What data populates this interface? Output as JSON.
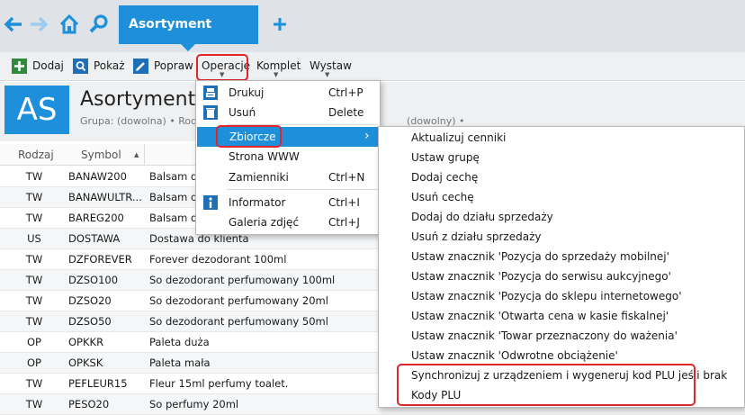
{
  "nav": {
    "active_tab": "Asortyment"
  },
  "toolbar": {
    "items": [
      {
        "label": "Dodaj"
      },
      {
        "label": "Pokaż"
      },
      {
        "label": "Popraw"
      },
      {
        "label": "Operacje"
      },
      {
        "label": "Komplet"
      },
      {
        "label": "Wystaw"
      }
    ]
  },
  "header": {
    "tile": "AS",
    "title": "Asortyment",
    "filter_left": "Grupa: (dowolna) • Rodz",
    "filter_right": "(dowolny) •"
  },
  "table": {
    "columns": [
      "Rodzaj",
      "Symbol"
    ],
    "rows": [
      {
        "kind": "TW",
        "symbol": "BANAW200",
        "name": "Balsam do"
      },
      {
        "kind": "TW",
        "symbol": "BANAWULTR...",
        "name": "Balsam do"
      },
      {
        "kind": "TW",
        "symbol": "BAREG200",
        "name": "Balsam do"
      },
      {
        "kind": "US",
        "symbol": "DOSTAWA",
        "name": "Dostawa do klienta"
      },
      {
        "kind": "TW",
        "symbol": "DZFOREVER",
        "name": "Forever dezodorant 100ml"
      },
      {
        "kind": "TW",
        "symbol": "DZSO100",
        "name": "So dezodorant perfumowany 100ml"
      },
      {
        "kind": "TW",
        "symbol": "DZSO20",
        "name": "So dezodorant perfumowany 20ml"
      },
      {
        "kind": "TW",
        "symbol": "DZSO50",
        "name": "So dezodorant perfumowany 50ml"
      },
      {
        "kind": "OP",
        "symbol": "OPKKR",
        "name": "Paleta duża"
      },
      {
        "kind": "OP",
        "symbol": "OPKSK",
        "name": "Paleta mała"
      },
      {
        "kind": "TW",
        "symbol": "PEFLEUR15",
        "name": "Fleur 15ml perfumy toalet."
      },
      {
        "kind": "TW",
        "symbol": "PESO20",
        "name": "So perfumy 20ml"
      }
    ]
  },
  "menu": {
    "items": [
      {
        "label": "Drukuj",
        "shortcut": "Ctrl+P"
      },
      {
        "label": "Usuń",
        "shortcut": "Delete"
      },
      {
        "label": "Zbiorcze",
        "shortcut": "›"
      },
      {
        "label": "Strona WWW",
        "shortcut": ""
      },
      {
        "label": "Zamienniki",
        "shortcut": "Ctrl+N"
      },
      {
        "label": "Informator",
        "shortcut": "Ctrl+I"
      },
      {
        "label": "Galeria zdjęć",
        "shortcut": "Ctrl+J"
      }
    ]
  },
  "submenu": {
    "items": [
      "Aktualizuj cenniki",
      "Ustaw grupę",
      "Dodaj cechę",
      "Usuń cechę",
      "Dodaj do działu sprzedaży",
      "Usuń z działu sprzedaży",
      "Ustaw znacznik 'Pozycja do sprzedaży mobilnej'",
      "Ustaw znacznik 'Pozycja do serwisu aukcyjnego'",
      "Ustaw znacznik 'Pozycja do sklepu internetowego'",
      "Ustaw znacznik 'Otwarta cena w kasie fiskalnej'",
      "Ustaw znacznik 'Towar przeznaczony do ważenia'",
      "Ustaw znacznik 'Odwrotne obciążenie'",
      "Synchronizuj z urządzeniem i wygeneruj kod PLU jeśli brak",
      "Kody PLU"
    ]
  },
  "colors": {
    "accent": "#1e8fdb",
    "highlight": "#e0252b"
  }
}
